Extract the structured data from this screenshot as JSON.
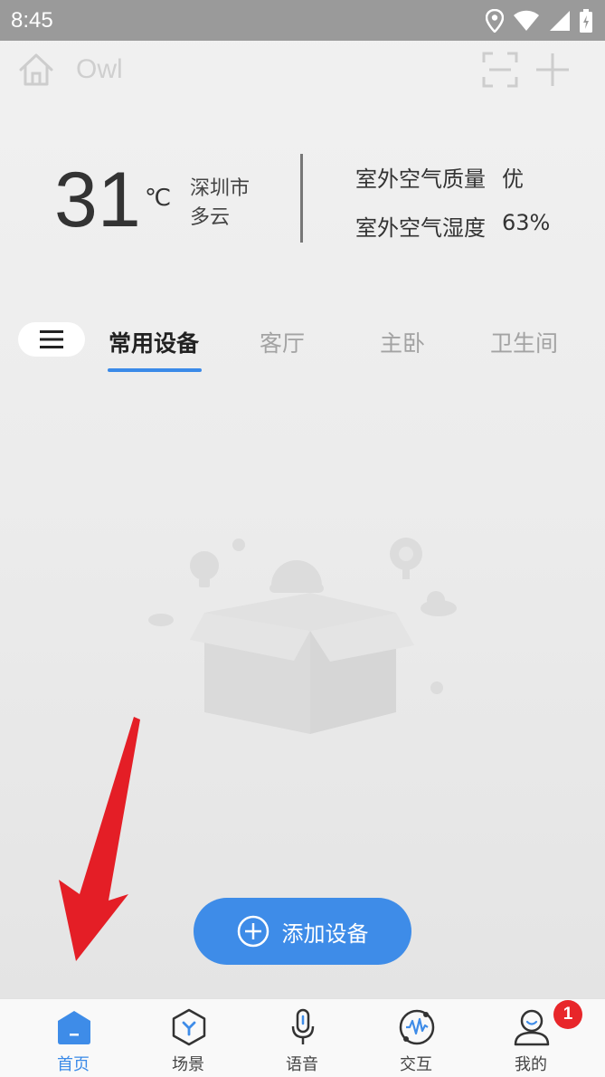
{
  "status_bar": {
    "time": "8:45"
  },
  "header": {
    "home_name": "Owl"
  },
  "weather": {
    "temperature": "31",
    "unit": "℃",
    "city": "深圳市",
    "condition": "多云",
    "air_quality_label": "室外空气质量",
    "air_quality_value": "优",
    "humidity_label": "室外空气湿度",
    "humidity_value": "63%"
  },
  "tabs": [
    {
      "label": "常用设备",
      "active": true
    },
    {
      "label": "客厅",
      "active": false
    },
    {
      "label": "主卧",
      "active": false
    },
    {
      "label": "卫生间",
      "active": false
    }
  ],
  "add_device": {
    "label": "添加设备"
  },
  "bottom_nav": [
    {
      "label": "首页",
      "icon": "home-icon",
      "active": true
    },
    {
      "label": "场景",
      "icon": "scene-icon",
      "active": false
    },
    {
      "label": "语音",
      "icon": "microphone-icon",
      "active": false
    },
    {
      "label": "交互",
      "icon": "interaction-icon",
      "active": false
    },
    {
      "label": "我的",
      "icon": "profile-icon",
      "active": false
    }
  ],
  "notification_badge": "1",
  "colors": {
    "accent": "#3e8ce8",
    "badge": "#e8262a",
    "annotation_arrow": "#e41e26"
  }
}
